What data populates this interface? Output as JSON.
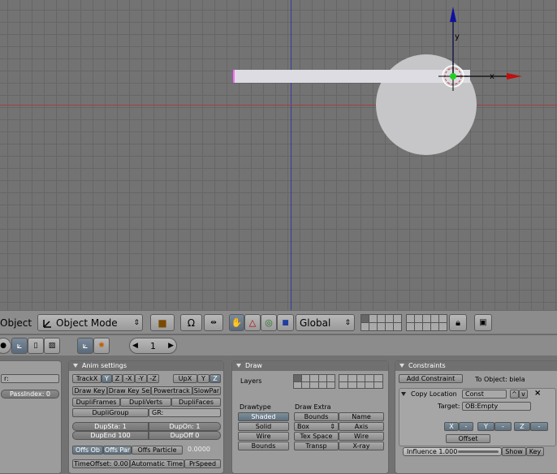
{
  "header": {
    "editor_label": "Object",
    "mode_select": "Object Mode",
    "orientation_select": "Global"
  },
  "subheader": {
    "frame_value": "1"
  },
  "object_panel": {
    "field_value": "r:",
    "pass_index": "PassIndex: 0"
  },
  "anim_panel": {
    "title": "Anim settings",
    "trackx": "TrackX",
    "y": "Y",
    "z": "Z",
    "mx": "-X",
    "my": "-Y",
    "mz": "-Z",
    "upx": "UpX",
    "upy": "Y",
    "upz": "Z",
    "draw_key": "Draw Key",
    "draw_key_sel": "Draw Key Se",
    "powertrack": "Powertrack",
    "slow_par": "SlowPar",
    "dupli_frames": "DupliFrames",
    "dupli_verts": "DupliVerts",
    "dupli_faces": "DupliFaces",
    "dupli_group": "DupliGroup",
    "gr_field": "GR:",
    "dup_sta": "DupSta: 1",
    "dup_on": "DupOn: 1",
    "dup_end": "DupEnd 100",
    "dup_off": "DupOff 0",
    "offs_ob": "Offs Ob",
    "offs_par": "Offs Par",
    "offs_particle": "Offs Particle",
    "offs_value": "0.0000",
    "time_offset": "TimeOffset: 0.00",
    "automatic_time": "Automatic Time",
    "prspeed": "PrSpeed"
  },
  "draw_panel": {
    "title": "Draw",
    "layers": "Layers",
    "drawtype": "Drawtype",
    "draw_extra": "Draw Extra",
    "shaded": "Shaded",
    "solid": "Solid",
    "wire": "Wire",
    "bounds": "Bounds",
    "bounds_btn": "Bounds",
    "box_select": "Box",
    "tex_space": "Tex Space",
    "transp": "Transp",
    "name": "Name",
    "axis": "Axis",
    "wire2": "Wire",
    "xray": "X-ray"
  },
  "constraints_panel": {
    "title": "Constraints",
    "add_constraint": "Add Constraint",
    "to_object": "To Object: biela",
    "copy_location": "Copy Location",
    "const_field": "Const",
    "target_label": "Target:",
    "target_field": "OB:Empty",
    "x": "X",
    "mx": "-",
    "y": "Y",
    "my": "-",
    "z": "Z",
    "mz": "-",
    "offset": "Offset",
    "influence": "Influence 1.000",
    "show": "Show",
    "key": "Key"
  },
  "colors": {
    "viewport_bg": "#737373",
    "grid": "#666666",
    "x_axis": "#a04040",
    "y_axis": "#3a3aa0",
    "selected_edge": "#ff66ff",
    "panel_bg": "#9c9c9c"
  },
  "icons": [
    "object-mode-icon",
    "camera-lock-icon",
    "rotate-icon",
    "manipulator-icon",
    "hand-icon",
    "triangle-icon",
    "circle-icon",
    "square-icon",
    "lock-icon",
    "render-icon",
    "sphere-icon",
    "object-icon",
    "page-icon",
    "image-icon",
    "axes-icon",
    "particles-icon"
  ]
}
